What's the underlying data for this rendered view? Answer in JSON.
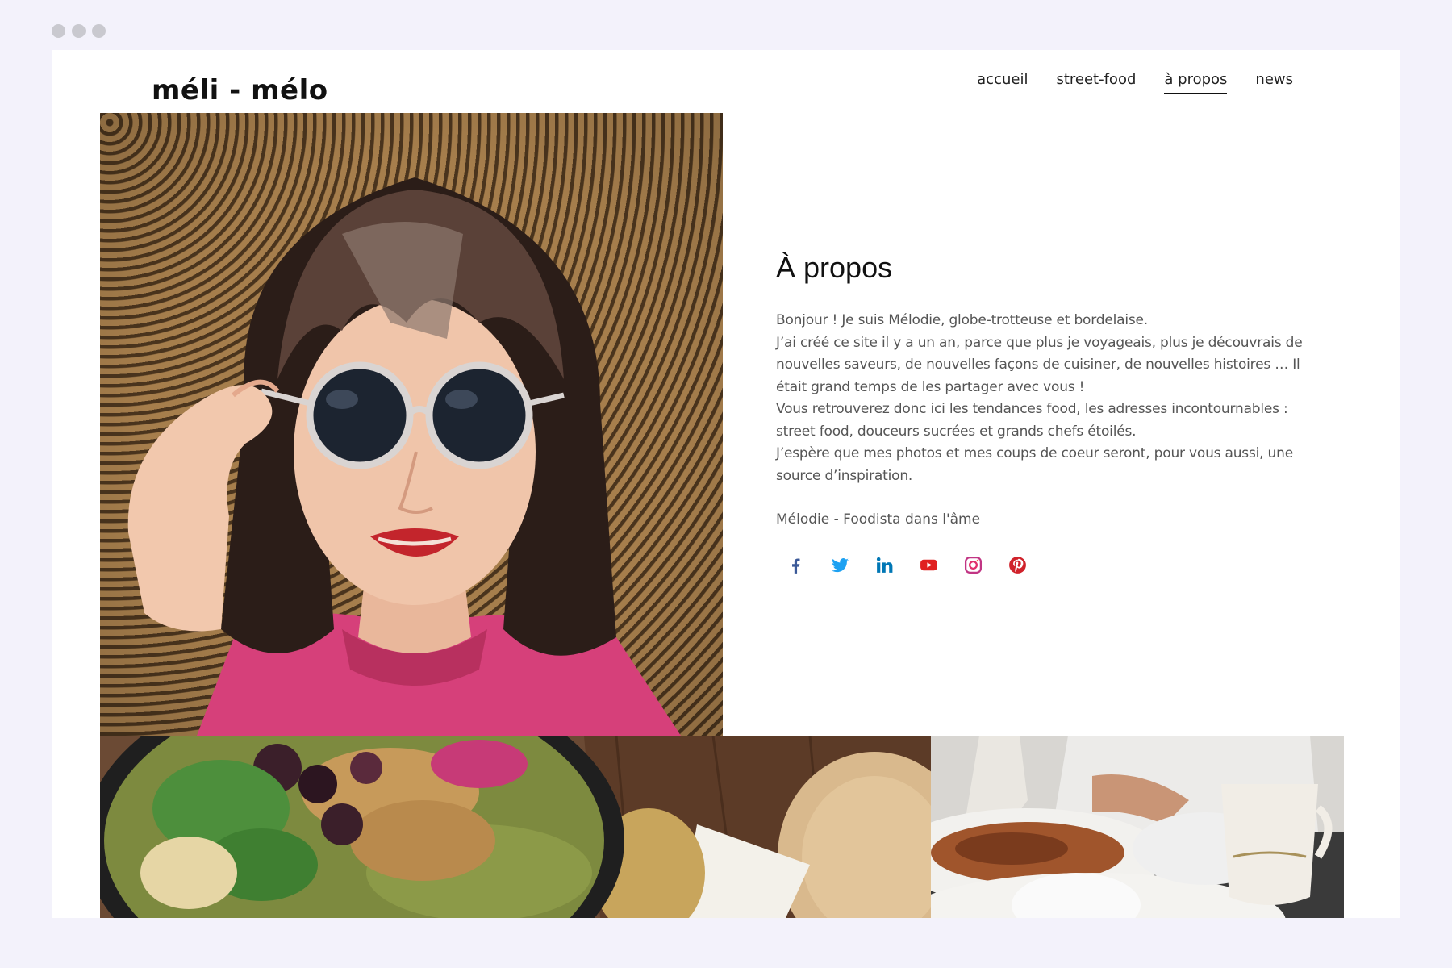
{
  "site": {
    "logo": "méli - mélo"
  },
  "nav": {
    "items": [
      {
        "label": "accueil"
      },
      {
        "label": "street-food"
      },
      {
        "label": "à propos"
      },
      {
        "label": "news"
      }
    ],
    "active_index": 2
  },
  "about": {
    "title": "À propos",
    "paragraphs": [
      "Bonjour ! Je suis Mélodie, globe-trotteuse et bordelaise.",
      "J’ai créé ce site il y a un an, parce que plus je voyageais, plus je découvrais de nouvelles saveurs, de nouvelles façons de cuisiner, de nouvelles histoires … Il était grand temps de les partager avec vous !",
      "Vous retrouverez donc ici les tendances food, les adresses incontournables : street food, douceurs sucrées et grands chefs étoilés.",
      "J’espère que mes photos et mes coups de coeur seront, pour vous aussi, une source d’inspiration."
    ],
    "signature": "Mélodie - Foodista dans l'âme"
  },
  "social": [
    {
      "icon": "facebook-icon",
      "color": "#3b5998"
    },
    {
      "icon": "twitter-icon",
      "color": "#1da1f2"
    },
    {
      "icon": "linkedin-icon",
      "color": "#0077b5"
    },
    {
      "icon": "youtube-icon",
      "color": "#e02020"
    },
    {
      "icon": "instagram-icon",
      "color": "#c13584"
    },
    {
      "icon": "pinterest-icon",
      "color": "#d0222b"
    }
  ],
  "images": {
    "portrait": "woman-sunglasses-portrait",
    "food_1": "smoothie-bowl-photo",
    "food_2": "restaurant-plates-photo"
  }
}
